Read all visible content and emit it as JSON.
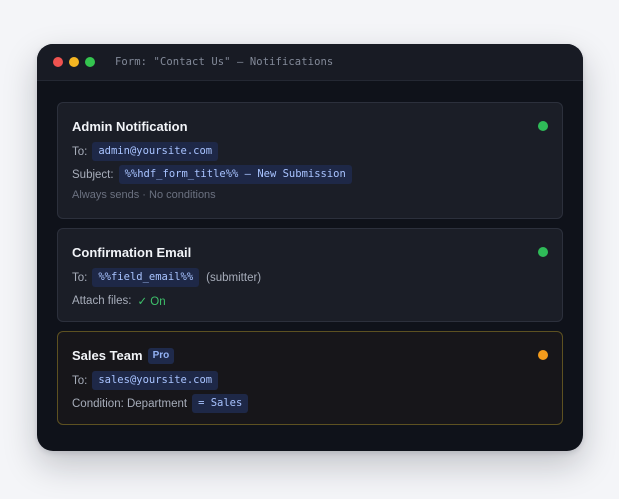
{
  "window": {
    "title": "Form: \"Contact Us\" — Notifications",
    "controls": {
      "close_color": "#ef5350",
      "minimize_color": "#f4b522",
      "maximize_color": "#34c44f"
    }
  },
  "notifications": [
    {
      "title": "Admin Notification",
      "status_color": "#2fbb58",
      "to_label": "To:",
      "to_value": "admin@yoursite.com",
      "subject_label": "Subject:",
      "subject_value": "%%hdf_form_title%% — New Submission",
      "note": "Always sends · No conditions"
    },
    {
      "title": "Confirmation Email",
      "status_color": "#2fbb58",
      "to_label": "To:",
      "to_value": "%%field_email%%",
      "to_suffix": "(submitter)",
      "attach_label": "Attach files:",
      "attach_value": "✓ On"
    },
    {
      "title": "Sales Team",
      "badge": "Pro",
      "status_color": "#f39b1c",
      "to_label": "To:",
      "to_value": "sales@yoursite.com",
      "condition_label": "Condition: Department",
      "condition_value": "= Sales"
    }
  ]
}
